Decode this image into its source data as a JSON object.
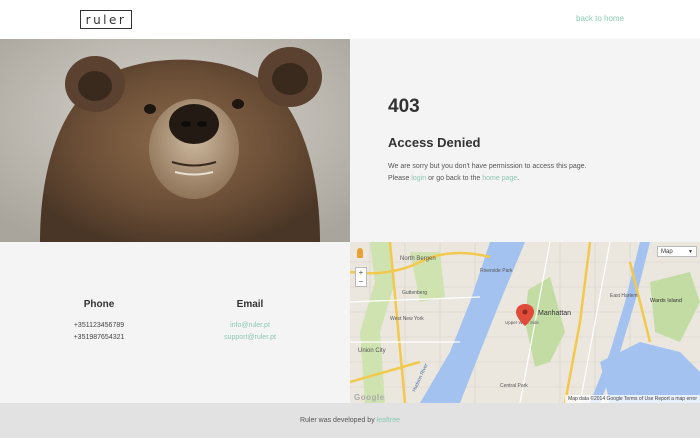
{
  "header": {
    "logo_text": "ruler",
    "back_link": "back to home"
  },
  "error": {
    "code": "403",
    "title": "Access Denied",
    "line1": "We are sorry but you don't have permission to access this page.",
    "line2_pre": "Please ",
    "login_link": "login",
    "line2_mid": " or go back to the ",
    "home_link": "home page",
    "line2_post": "."
  },
  "contact": {
    "phone_heading": "Phone",
    "phones": [
      "+351123456789",
      "+351987654321"
    ],
    "email_heading": "Email",
    "emails": [
      "info@ruler.pt",
      "support@ruler.pt"
    ]
  },
  "map": {
    "type_select": "Map",
    "zoom_in": "+",
    "zoom_out": "−",
    "footer_text": "Map data ©2014 Google   Terms of Use   Report a map error",
    "google": "Google",
    "labels": {
      "north_bergen": "North Bergen",
      "manhattan": "Manhattan",
      "west_new_york": "West New York",
      "guttenberg": "Guttenberg",
      "union_city": "Union City",
      "riverside_park": "Riverside Park",
      "upper_west_side": "Upper West Side",
      "east_harlem": "East Harlem",
      "wards_island": "Wards Island",
      "central_park": "Central Park",
      "hudson_river": "Hudson River"
    }
  },
  "footer": {
    "pre": "Ruler was developed by ",
    "link": "leaftree"
  }
}
